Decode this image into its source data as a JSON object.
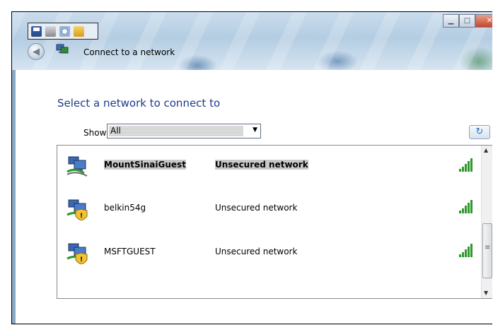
{
  "window": {
    "title": "Connect to a network",
    "buttons": {
      "minimize": "▁",
      "maximize": "□",
      "close": "✕"
    }
  },
  "icons": {
    "back": "◀",
    "refresh": "↻"
  },
  "main": {
    "heading": "Select a network to connect to",
    "show_label": "Show",
    "show_value": "All"
  },
  "networks": [
    {
      "name": "MountSinaiGuest",
      "status": "Unsecured network",
      "selected": true
    },
    {
      "name": "belkin54g",
      "status": "Unsecured network",
      "selected": false
    },
    {
      "name": "MSFTGUEST",
      "status": "Unsecured network",
      "selected": false
    }
  ],
  "colors": {
    "heading": "#1e3a8a",
    "signal": "#2e9a2e"
  }
}
